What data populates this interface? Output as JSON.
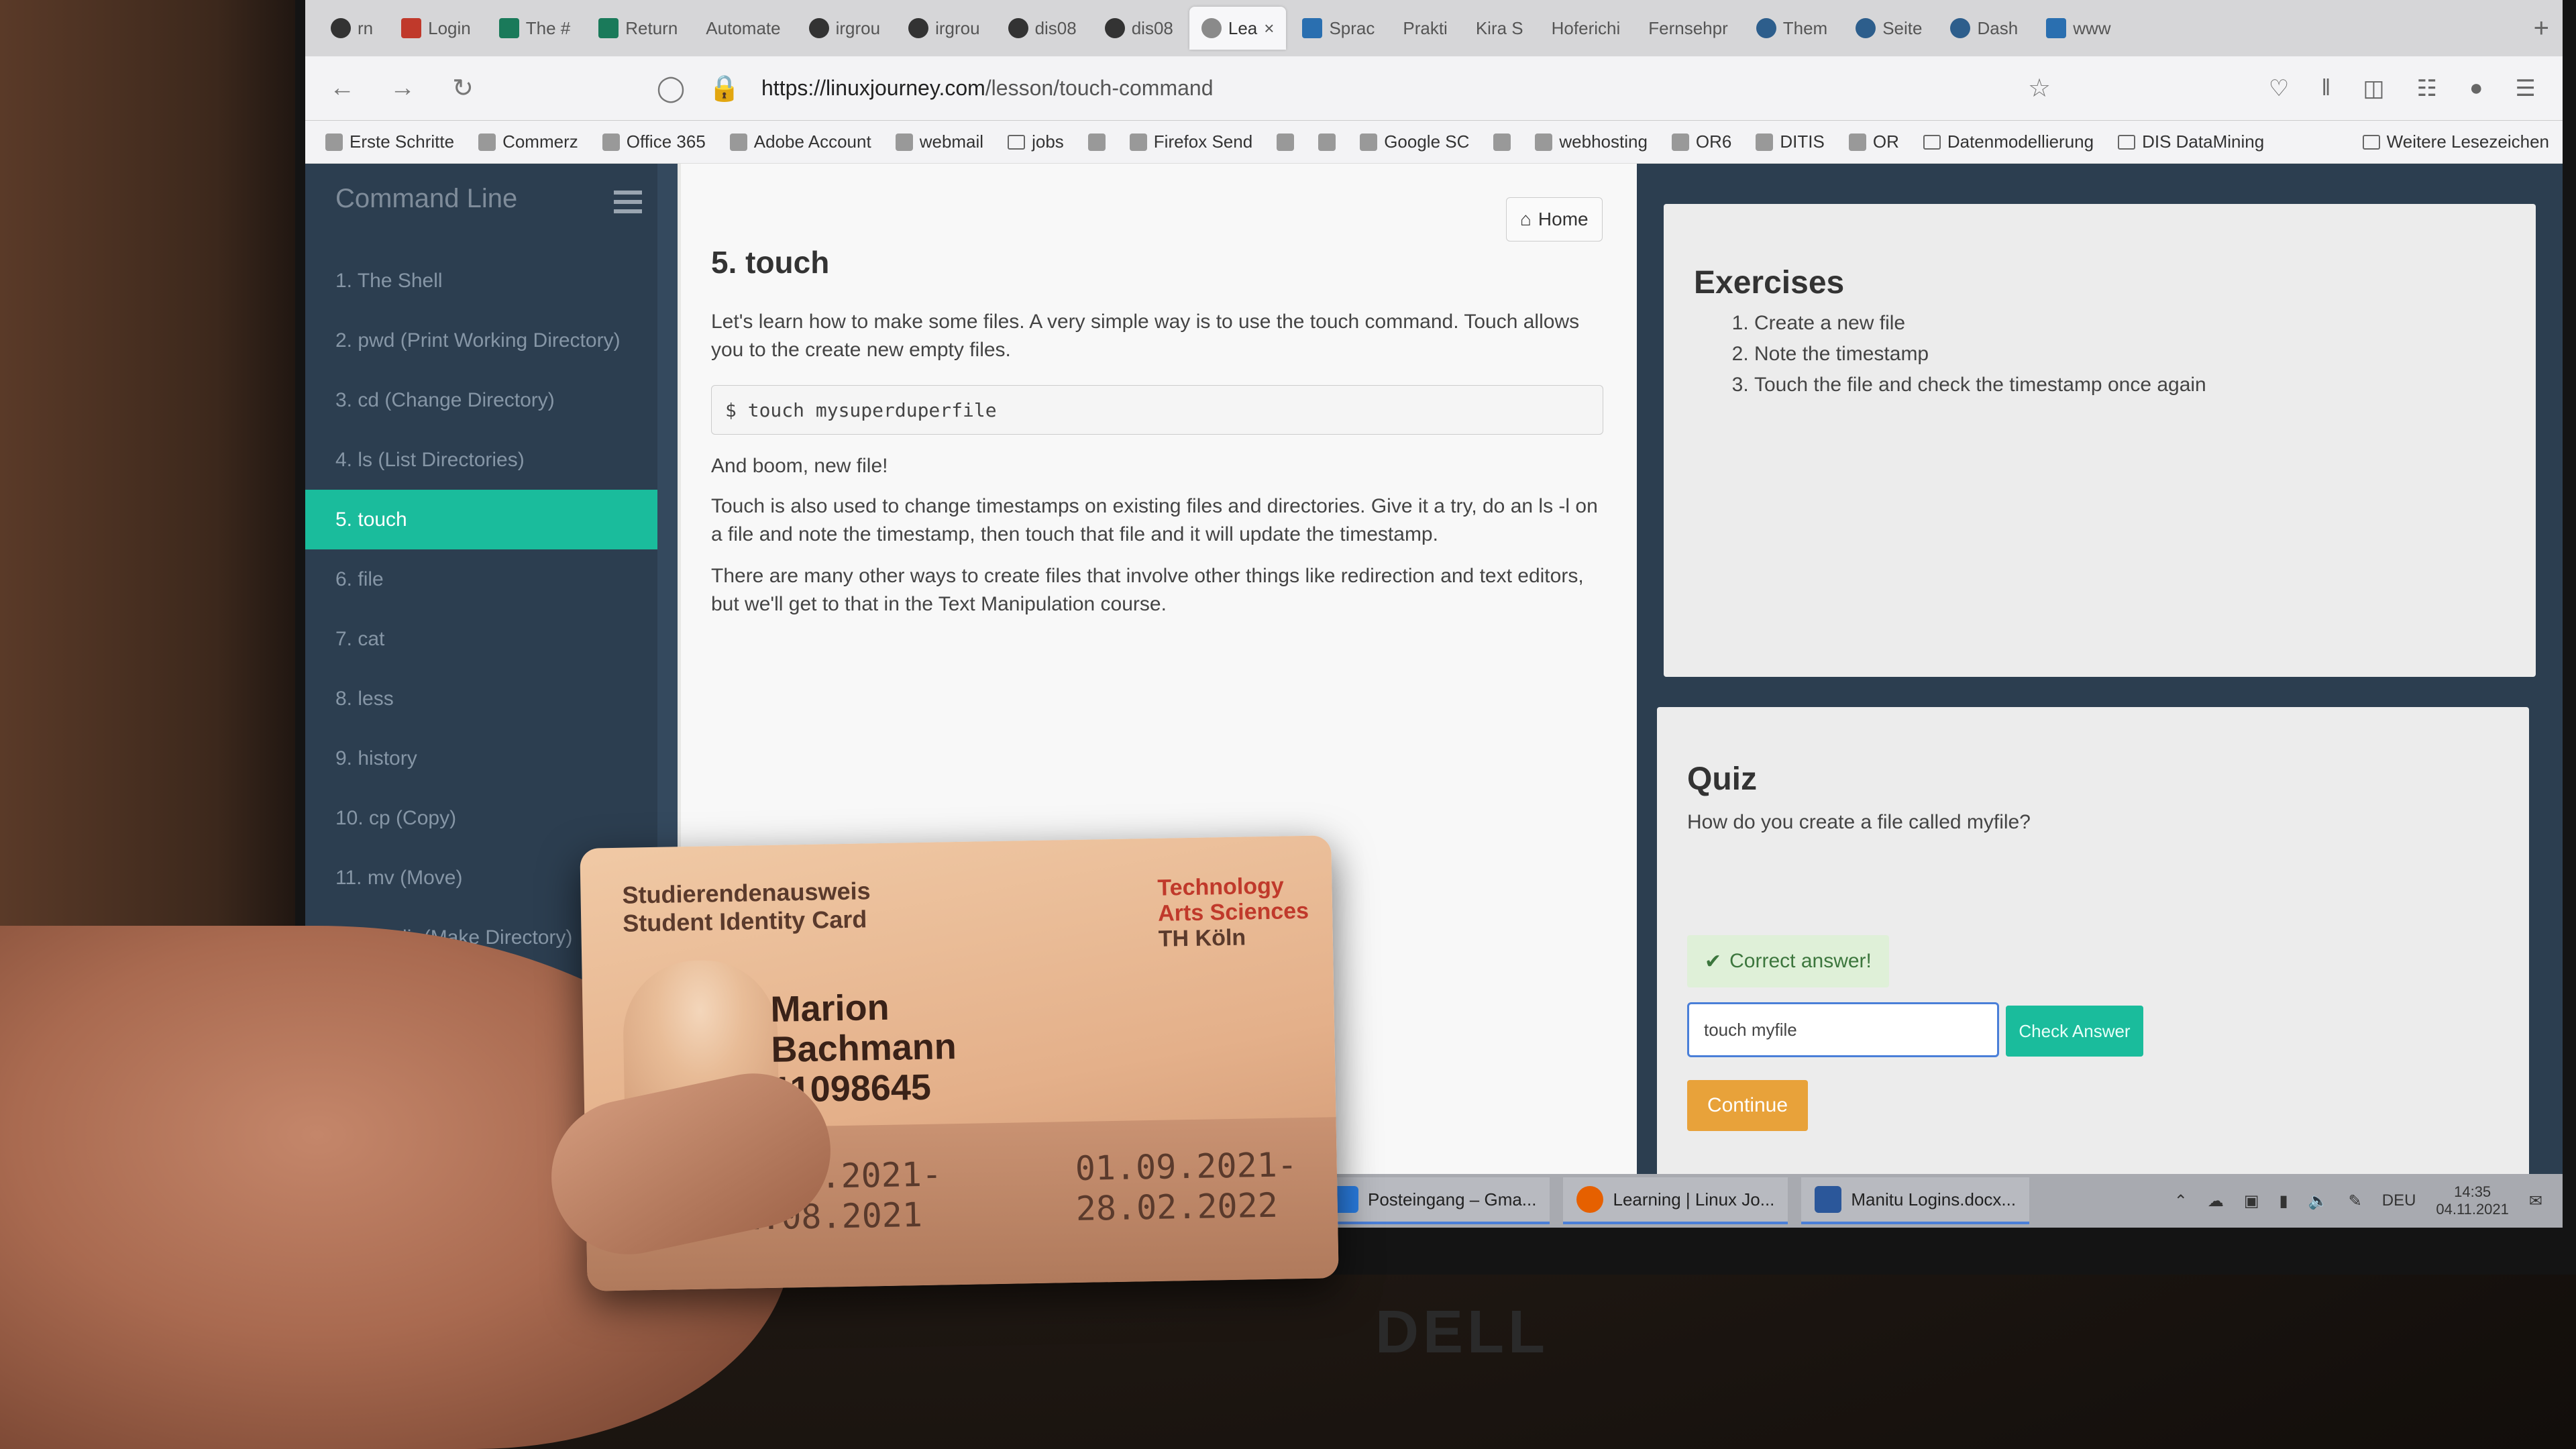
{
  "browser": {
    "tabs": [
      {
        "label": "rn",
        "icon": "back-tab-icon"
      },
      {
        "label": "Login",
        "icon": "login-icon"
      },
      {
        "label": "The #",
        "icon": "sheet-icon"
      },
      {
        "label": "Return",
        "icon": "sheet-icon"
      },
      {
        "label": "Automate",
        "icon": ""
      },
      {
        "label": "irgrou",
        "icon": "github-icon"
      },
      {
        "label": "irgrou",
        "icon": "github-icon"
      },
      {
        "label": "dis08",
        "icon": "github-icon"
      },
      {
        "label": "dis08",
        "icon": "github-icon"
      },
      {
        "label": "Lea",
        "icon": "linux-journey-icon",
        "active": true
      },
      {
        "label": "Sprac",
        "icon": "video-icon"
      },
      {
        "label": "Prakti",
        "icon": ""
      },
      {
        "label": "Kira S",
        "icon": ""
      },
      {
        "label": "Hoferichi",
        "icon": ""
      },
      {
        "label": "Fernsehpr",
        "icon": ""
      },
      {
        "label": "Them",
        "icon": "wordpress-icon"
      },
      {
        "label": "Seite",
        "icon": "wordpress-icon"
      },
      {
        "label": "Dash",
        "icon": "wordpress-icon"
      },
      {
        "label": "www",
        "icon": "m-icon"
      }
    ],
    "url_domain": "https://linuxjourney.com",
    "url_path": "/lesson/touch-command",
    "bookmarks": [
      "Erste Schritte",
      "Commerz",
      "Office 365",
      "Adobe Account",
      "webmail",
      "jobs",
      "",
      "Firefox Send",
      "",
      "",
      "Google SC",
      "",
      "webhosting",
      "OR6",
      "DITIS",
      "OR",
      "Datenmodellierung",
      "DIS DataMining"
    ],
    "more_bookmarks": "Weitere Lesezeichen"
  },
  "sidebar": {
    "title": "Command Line",
    "items": [
      "1. The Shell",
      "2. pwd (Print Working Directory)",
      "3. cd (Change Directory)",
      "4. ls (List Directories)",
      "5. touch",
      "6. file",
      "7. cat",
      "8. less",
      "9. history",
      "10. cp (Copy)",
      "11. mv (Move)",
      "12. mkdir (Make Directory)"
    ],
    "active_index": 4
  },
  "lesson": {
    "home_label": "Home",
    "title": "5. touch",
    "intro": "Let's learn how to make some files. A very simple way is to use the touch command. Touch allows you to the create new empty files.",
    "code": "$ touch mysuperduperfile",
    "boom": "And boom, new file!",
    "para2": "Touch is also used to change timestamps on existing files and directories. Give it a try, do an ls -l on a file and note the timestamp, then touch that file and it will update the timestamp.",
    "para3": "There are many other ways to create files that involve other things like redirection and text editors, but we'll get to that in the Text Manipulation course."
  },
  "exercises": {
    "title": "Exercises",
    "items": [
      "Create a new file",
      "Note the timestamp",
      "Touch the file and check the timestamp once again"
    ]
  },
  "quiz": {
    "title": "Quiz",
    "question": "How do you create a file called myfile?",
    "feedback": "Correct answer!",
    "answer": "touch myfile",
    "check_label": "Check Answer",
    "continue_label": "Continue"
  },
  "taskbar": {
    "apps": [
      "Posteingang – Gma...",
      "Learning | Linux Jo...",
      "Manitu Logins.docx..."
    ],
    "lang": "DEU",
    "time": "14:35",
    "date": "04.11.2021"
  },
  "card": {
    "title_de": "Studierendenausweis",
    "title_en": "Student Identity Card",
    "inst_1": "Technology",
    "inst_2": "Arts Sciences",
    "inst_3": "TH Köln",
    "first_name": "Marion",
    "last_name": "Bachmann",
    "number": "11098645",
    "date_left_1": "01.03.2021-",
    "date_left_2": "31.08.2021",
    "date_right_1": "01.09.2021-",
    "date_right_2": "28.02.2022"
  },
  "monitor_brand": "DELL",
  "colors": {
    "sidebar_bg": "#2c3e50",
    "active_teal": "#1abc9c",
    "continue_orange": "#e8a23a",
    "correct_bg": "#dff0d8"
  }
}
